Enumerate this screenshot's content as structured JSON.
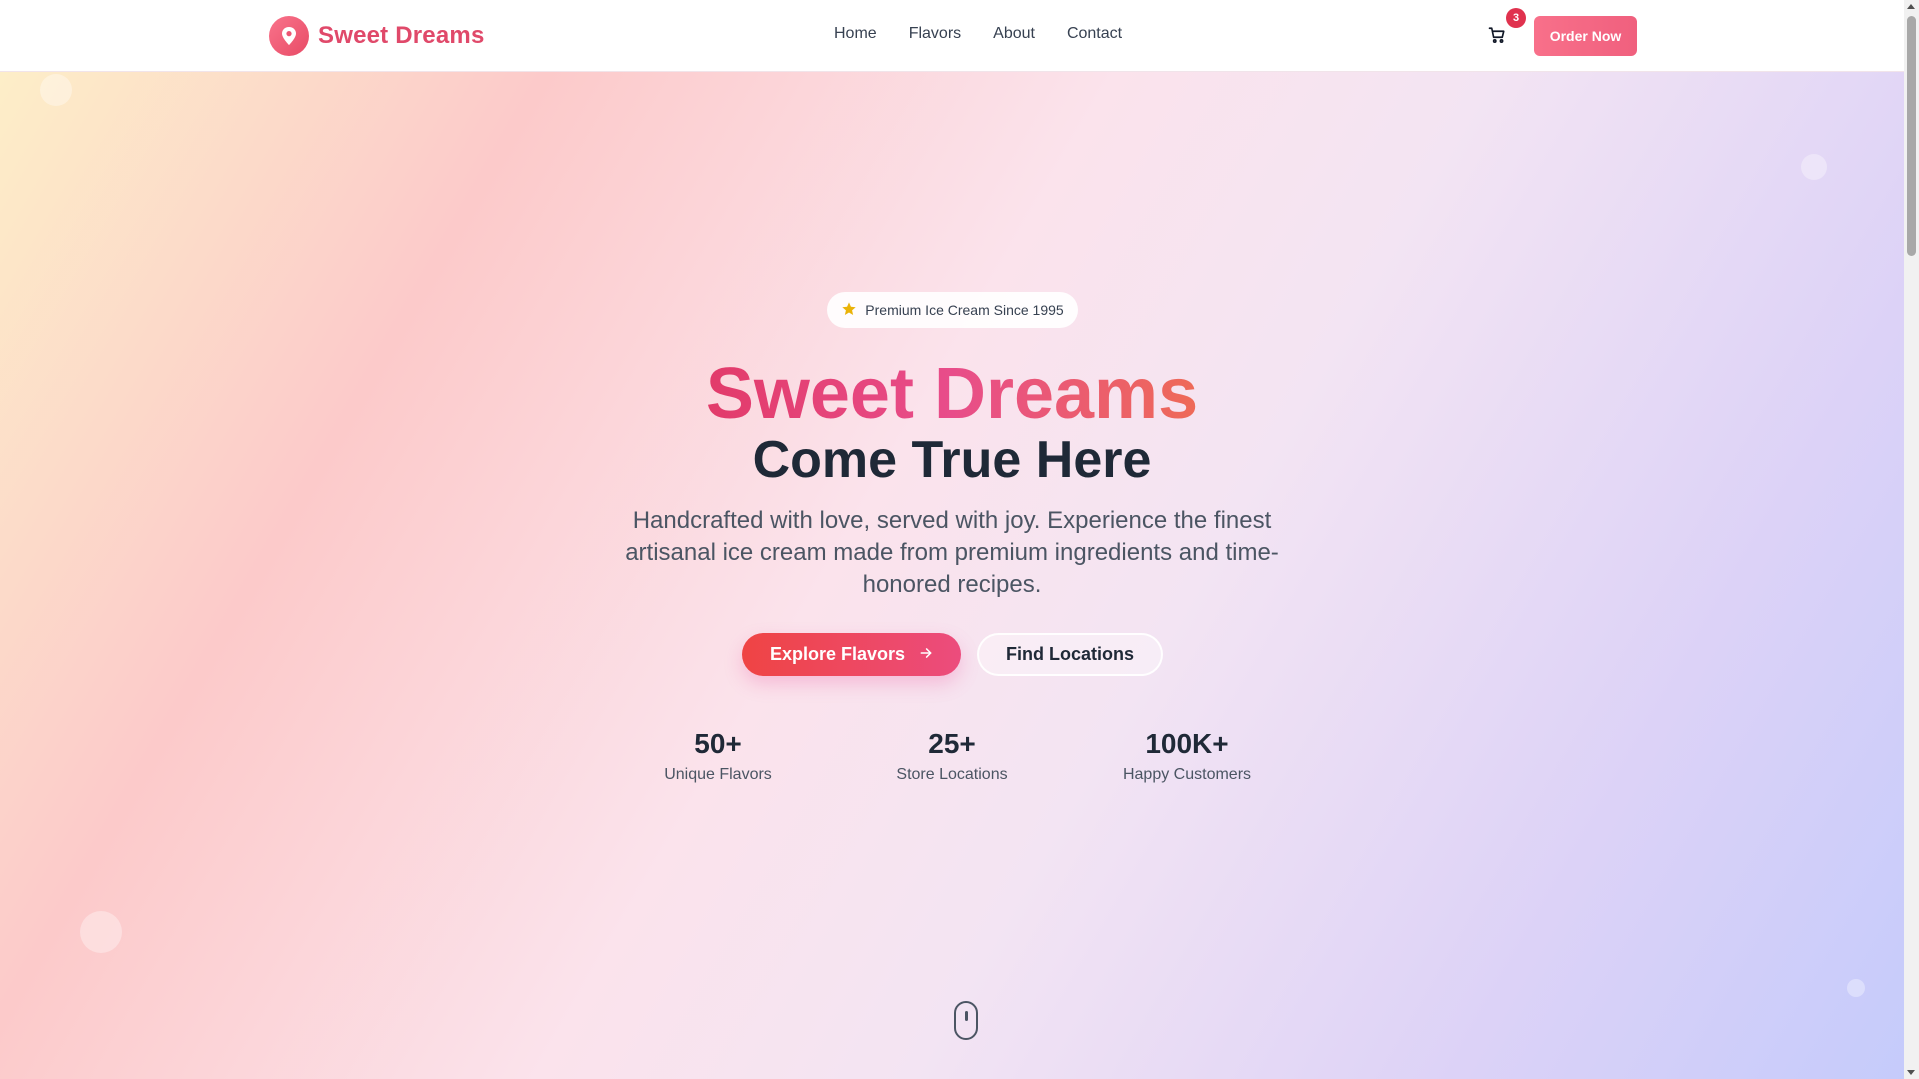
{
  "brand": {
    "name": "Sweet Dreams"
  },
  "nav": {
    "items": [
      {
        "label": "Home"
      },
      {
        "label": "Flavors"
      },
      {
        "label": "About"
      },
      {
        "label": "Contact"
      }
    ]
  },
  "cart": {
    "count": "3"
  },
  "header": {
    "order_button": "Order Now"
  },
  "hero": {
    "badge": "Premium Ice Cream Since 1995",
    "title_line1": "Sweet Dreams",
    "title_line2": "Come True Here",
    "description": "Handcrafted with love, served with joy. Experience the finest artisanal ice cream made from premium ingredients and time-honored recipes.",
    "primary_button": "Explore Flavors",
    "secondary_button": "Find Locations"
  },
  "stats": [
    {
      "value": "50+",
      "label": "Unique Flavors"
    },
    {
      "value": "25+",
      "label": "Store Locations"
    },
    {
      "value": "100K+",
      "label": "Happy Customers"
    }
  ],
  "colors": {
    "brand": "#e0496a",
    "accent_gradient_start": "#ef4444",
    "accent_gradient_end": "#ec4c7d",
    "star": "#eab308"
  },
  "icons": {
    "logo": "map-pin-icon",
    "cart": "shopping-cart-icon",
    "badge": "star-icon",
    "primary_button": "arrow-right-icon",
    "scroll": "mouse-scroll-icon"
  }
}
